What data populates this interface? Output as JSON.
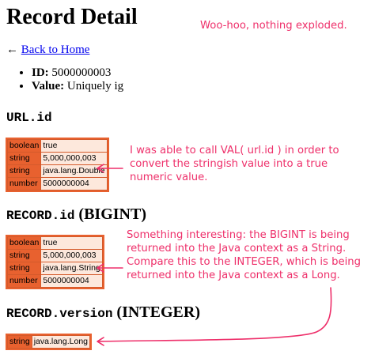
{
  "page": {
    "title": "Record Detail",
    "back_arrow": "←",
    "back_link": "Back to Home",
    "meta": [
      {
        "label": "ID:",
        "value": "5000000003"
      },
      {
        "label": "Value:",
        "value": "Uniquely ig"
      }
    ]
  },
  "sections": {
    "url": {
      "heading_code": "URL.id",
      "rows": [
        {
          "key": "boolean",
          "value": "true"
        },
        {
          "key": "string",
          "value": "5,000,000,003"
        },
        {
          "key": "string",
          "value": "java.lang.Double"
        },
        {
          "key": "number",
          "value": "5000000004"
        }
      ]
    },
    "record_id": {
      "heading_code": "RECORD.id",
      "heading_text": "(BIGINT)",
      "rows": [
        {
          "key": "boolean",
          "value": "true"
        },
        {
          "key": "string",
          "value": "5,000,000,003"
        },
        {
          "key": "string",
          "value": "java.lang.String"
        },
        {
          "key": "number",
          "value": "5000000004"
        }
      ]
    },
    "record_version": {
      "heading_code": "RECORD.version",
      "heading_text": "(INTEGER)",
      "rows": [
        {
          "key": "string",
          "value": "java.lang.Long"
        }
      ]
    }
  },
  "annotations": {
    "top": "Woo-hoo, nothing exploded.",
    "url_note": [
      "I was able to call VAL( url.id ) in order to",
      "convert the stringish value into a true",
      "numeric value."
    ],
    "record_note": [
      "Something interesting: the BIGINT is being",
      "returned into the Java context as a String.",
      "Compare this to the INTEGER, which is being",
      "returned into the Java context as a Long."
    ],
    "color": "#ee2f6a"
  },
  "theme": {
    "dump_key_bg": "#e8612f",
    "dump_value_bg": "#fde8dc",
    "link_color": "#0000ee"
  }
}
